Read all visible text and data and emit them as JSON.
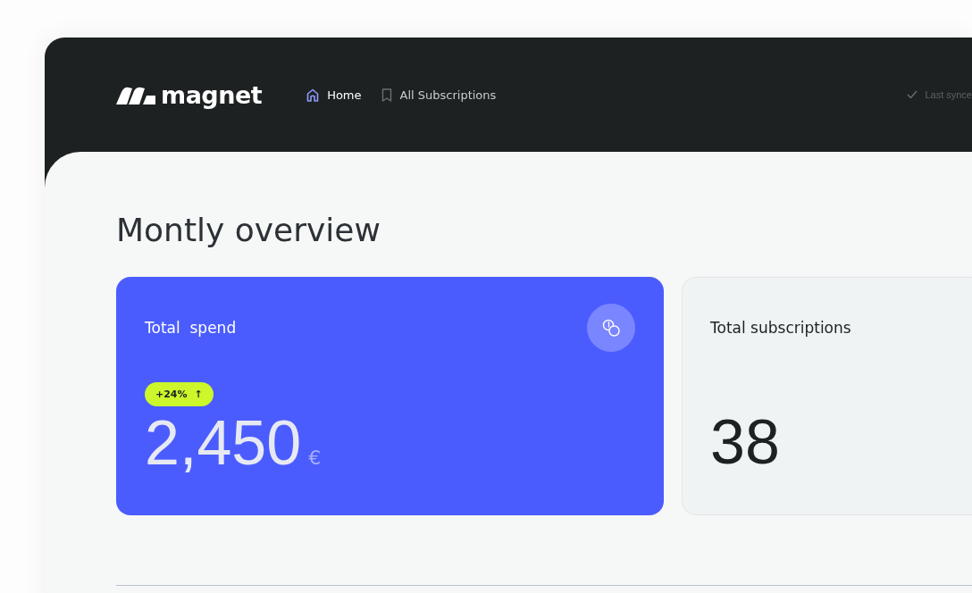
{
  "header": {
    "logo": "magnet",
    "nav": [
      {
        "label": "Home",
        "kind": "home",
        "selected": true
      },
      {
        "label": "All Subscriptions",
        "kind": "bookmark",
        "selected": false
      }
    ],
    "sync_status": "Last synce"
  },
  "page": {
    "title": "Montly overview",
    "cards": [
      {
        "kind": "spend",
        "label": "Total  spend",
        "badge": "+24%",
        "badge_arrow": "↑",
        "value": "2,450",
        "unit": "€"
      },
      {
        "kind": "count",
        "label": "Total subscriptions",
        "value": "38"
      }
    ]
  }
}
